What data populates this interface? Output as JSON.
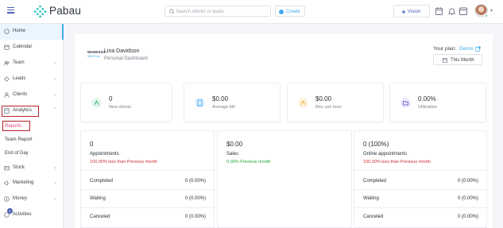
{
  "topbar": {
    "logo": "Pabau",
    "search_placeholder": "Search clients or leads",
    "create_label": "Create",
    "vision_label": "Vision"
  },
  "sidebar": {
    "items": [
      {
        "label": "Home",
        "icon": "home-icon",
        "chevron": false,
        "active": true
      },
      {
        "label": "Calendar",
        "icon": "calendar-icon",
        "chevron": false
      },
      {
        "label": "Team",
        "icon": "team-icon",
        "chevron": true
      },
      {
        "label": "Leads",
        "icon": "leads-icon",
        "chevron": true
      },
      {
        "label": "Clients",
        "icon": "clients-icon",
        "chevron": true
      },
      {
        "label": "Analytics",
        "icon": "analytics-icon",
        "chevron": true,
        "expanded": true
      }
    ],
    "analytics_sub": [
      {
        "label": "Reports",
        "active": true
      },
      {
        "label": "Team Report"
      },
      {
        "label": "End of Day"
      }
    ],
    "lower_items": [
      {
        "label": "Stock",
        "icon": "stock-icon",
        "chevron": true
      },
      {
        "label": "Marketing",
        "icon": "marketing-icon",
        "chevron": true
      },
      {
        "label": "Money",
        "icon": "money-icon",
        "chevron": true
      },
      {
        "label": "Activities",
        "icon": "activities-icon",
        "chevron": false
      }
    ]
  },
  "dashboard": {
    "logo_line1": "WANESSA",
    "logo_line2": "MEDICAL",
    "user_name": "Lina Davidson",
    "subtitle": "Personal Dashboard",
    "plan_label": "Your plan:",
    "plan_value": "Demo",
    "period_label": "This Month"
  },
  "stat_cards": [
    {
      "value": "0",
      "label": "New clients",
      "icon": "new-clients-icon",
      "color": "#3db87a"
    },
    {
      "value": "$0.00",
      "label": "Average bill",
      "icon": "bill-icon",
      "color": "#43a9f0"
    },
    {
      "value": "$0.00",
      "label": "Rev. per hour",
      "icon": "revenue-icon",
      "color": "#f0b43c"
    },
    {
      "value": "0.00%",
      "label": "Utilization",
      "icon": "utilization-icon",
      "color": "#7b6fd6"
    }
  ],
  "detail_cards": [
    {
      "value": "0",
      "label": "Appointments",
      "delta": "100.00% less than Previous month",
      "delta_color": "red",
      "rows": [
        {
          "label": "Completed",
          "value": "0 (0.00%)"
        },
        {
          "label": "Waiting",
          "value": "0 (0.00%)"
        },
        {
          "label": "Canceled",
          "value": "0 (0.00%)"
        }
      ]
    },
    {
      "value": "$0.00",
      "label": "Sales",
      "delta": "0.00% Previous month",
      "delta_color": "green",
      "rows": []
    },
    {
      "value": "0 (100%)",
      "label": "Online appointments",
      "delta": "100.00% less than Previous month",
      "delta_color": "red",
      "rows": [
        {
          "label": "Completed",
          "value": "0 (0.00%)"
        },
        {
          "label": "Waiting",
          "value": "0 (0.00%)"
        },
        {
          "label": "Canceled",
          "value": "0 (0.00%)"
        }
      ]
    }
  ],
  "activities_badge": "2"
}
